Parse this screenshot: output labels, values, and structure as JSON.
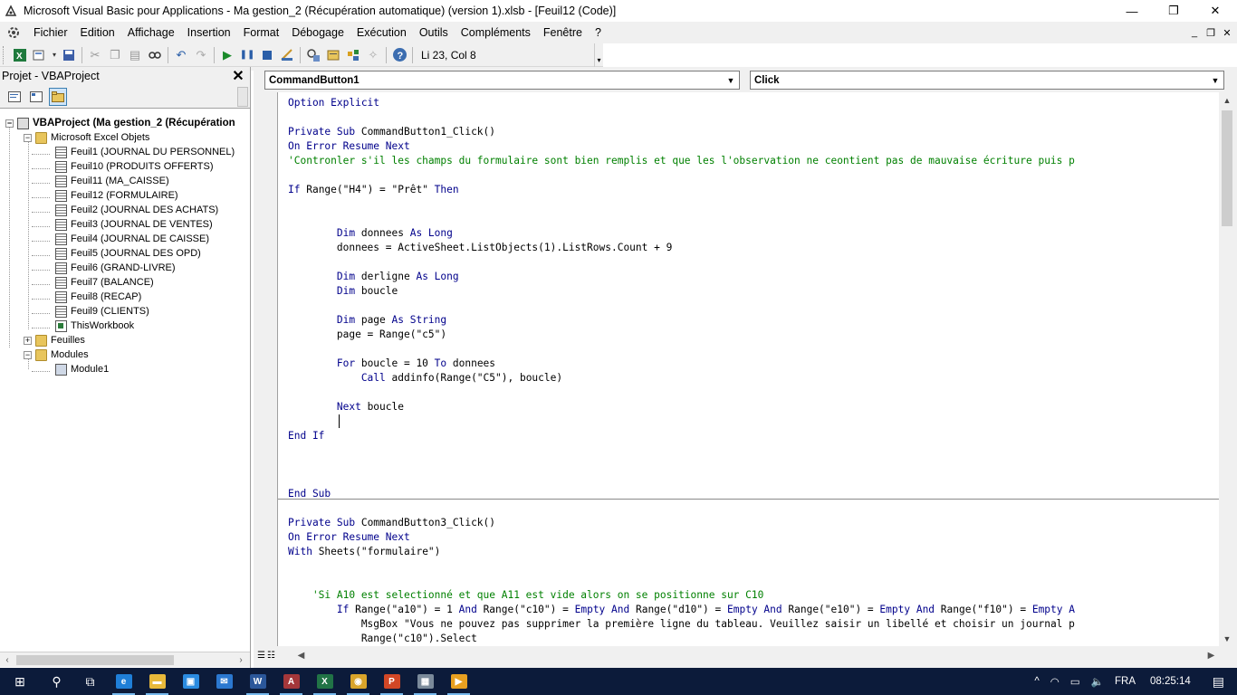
{
  "window": {
    "title": "Microsoft Visual Basic pour Applications - Ma gestion_2 (Récupération automatique) (version 1).xlsb - [Feuil12 (Code)]",
    "minimize": "—",
    "restore": "❐",
    "close": "✕"
  },
  "menu": {
    "items": [
      "Fichier",
      "Edition",
      "Affichage",
      "Insertion",
      "Format",
      "Débogage",
      "Exécution",
      "Outils",
      "Compléments",
      "Fenêtre",
      "?"
    ],
    "mdi_min": "_",
    "mdi_restore": "❐",
    "mdi_close": "✕"
  },
  "toolbar": {
    "status": "Li 23, Col 8",
    "icons": [
      "excel-icon",
      "insert-icon",
      "save-icon",
      "cut-icon",
      "copy-icon",
      "paste-icon",
      "find-icon",
      "undo-icon",
      "redo-icon",
      "run-icon",
      "pause-icon",
      "reset-icon",
      "design-mode-icon",
      "project-explorer-icon",
      "properties-icon",
      "object-browser-icon",
      "toolbox-icon",
      "help-icon"
    ]
  },
  "project": {
    "header": "Projet - VBAProject",
    "close_glyph": "✕",
    "tree": {
      "root": "VBAProject (Ma gestion_2 (Récupération",
      "excel_objects": "Microsoft Excel Objets",
      "sheets": [
        "Feuil1 (JOURNAL DU PERSONNEL)",
        "Feuil10 (PRODUITS OFFERTS)",
        "Feuil11 (MA_CAISSE)",
        "Feuil12 (FORMULAIRE)",
        "Feuil2 (JOURNAL DES ACHATS)",
        "Feuil3 (JOURNAL DE VENTES)",
        "Feuil4 (JOURNAL DE CAISSE)",
        "Feuil5 (JOURNAL DES OPD)",
        "Feuil6 (GRAND-LIVRE)",
        "Feuil7 (BALANCE)",
        "Feuil8 (RECAP)",
        "Feuil9 (CLIENTS)"
      ],
      "workbook": "ThisWorkbook",
      "feuilles": "Feuilles",
      "modules": "Modules",
      "module1": "Module1"
    }
  },
  "code": {
    "object_combo": "CommandButton1",
    "proc_combo": "Click",
    "lines": [
      [
        {
          "t": "Option Explicit",
          "c": "kw"
        }
      ],
      [],
      [
        {
          "t": "Private Sub ",
          "c": "kw"
        },
        {
          "t": "CommandButton1_Click()",
          "c": "tx"
        }
      ],
      [
        {
          "t": "On Error Resume Next",
          "c": "kw"
        }
      ],
      [
        {
          "t": "'Contronler s'il les champs du formulaire sont bien remplis et que les l'observation ne ceontient pas de mauvaise écriture puis p",
          "c": "cm"
        }
      ],
      [],
      [
        {
          "t": "If ",
          "c": "kw"
        },
        {
          "t": "Range(\"H4\") = \"Prêt\" ",
          "c": "tx"
        },
        {
          "t": "Then",
          "c": "kw"
        }
      ],
      [],
      [],
      [
        {
          "t": "        Dim ",
          "c": "kw"
        },
        {
          "t": "donnees ",
          "c": "tx"
        },
        {
          "t": "As Long",
          "c": "kw"
        }
      ],
      [
        {
          "t": "        donnees = ActiveSheet.ListObjects(1).ListRows.Count + 9",
          "c": "tx"
        }
      ],
      [],
      [
        {
          "t": "        Dim ",
          "c": "kw"
        },
        {
          "t": "derligne ",
          "c": "tx"
        },
        {
          "t": "As Long",
          "c": "kw"
        }
      ],
      [
        {
          "t": "        Dim ",
          "c": "kw"
        },
        {
          "t": "boucle",
          "c": "tx"
        }
      ],
      [],
      [
        {
          "t": "        Dim ",
          "c": "kw"
        },
        {
          "t": "page ",
          "c": "tx"
        },
        {
          "t": "As String",
          "c": "kw"
        }
      ],
      [
        {
          "t": "        page = Range(\"c5\")",
          "c": "tx"
        }
      ],
      [],
      [
        {
          "t": "        For ",
          "c": "kw"
        },
        {
          "t": "boucle = 10 ",
          "c": "tx"
        },
        {
          "t": "To ",
          "c": "kw"
        },
        {
          "t": "donnees",
          "c": "tx"
        }
      ],
      [
        {
          "t": "            Call ",
          "c": "kw"
        },
        {
          "t": "addinfo(Range(\"C5\"), boucle)",
          "c": "tx"
        }
      ],
      [],
      [
        {
          "t": "        Next ",
          "c": "kw"
        },
        {
          "t": "boucle",
          "c": "tx"
        }
      ],
      [],
      [
        {
          "t": "End If",
          "c": "kw"
        }
      ],
      [],
      [],
      [],
      [
        {
          "t": "End Sub",
          "c": "kw"
        }
      ],
      [],
      [
        {
          "t": "Private Sub ",
          "c": "kw"
        },
        {
          "t": "CommandButton3_Click()",
          "c": "tx"
        }
      ],
      [
        {
          "t": "On Error Resume Next",
          "c": "kw"
        }
      ],
      [
        {
          "t": "With ",
          "c": "kw"
        },
        {
          "t": "Sheets(\"formulaire\")",
          "c": "tx"
        }
      ],
      [],
      [],
      [
        {
          "t": "    'Si A10 est selectionné et que A11 est vide alors on se positionne sur C10",
          "c": "cm"
        }
      ],
      [
        {
          "t": "        If ",
          "c": "kw"
        },
        {
          "t": "Range(\"a10\") = 1 ",
          "c": "tx"
        },
        {
          "t": "And ",
          "c": "kw"
        },
        {
          "t": "Range(\"c10\") = ",
          "c": "tx"
        },
        {
          "t": "Empty And ",
          "c": "kw"
        },
        {
          "t": "Range(\"d10\") = ",
          "c": "tx"
        },
        {
          "t": "Empty And ",
          "c": "kw"
        },
        {
          "t": "Range(\"e10\") = ",
          "c": "tx"
        },
        {
          "t": "Empty And ",
          "c": "kw"
        },
        {
          "t": "Range(\"f10\") = ",
          "c": "tx"
        },
        {
          "t": "Empty A",
          "c": "kw"
        }
      ],
      [
        {
          "t": "            MsgBox ",
          "c": "tx"
        },
        {
          "t": "\"Vous ne pouvez pas supprimer la première ligne du tableau. Veuillez saisir un libellé et choisir un journal p",
          "c": "tx"
        }
      ],
      [
        {
          "t": "            Range(\"c10\").Select",
          "c": "tx"
        }
      ]
    ]
  },
  "taskbar": {
    "apps": [
      {
        "name": "start-button",
        "glyph": "⊞"
      },
      {
        "name": "search-button",
        "glyph": "⚲"
      },
      {
        "name": "task-view-button",
        "glyph": "⧉"
      },
      {
        "name": "edge-app",
        "glyph": "e",
        "color": "#1f7fd8"
      },
      {
        "name": "file-explorer-app",
        "glyph": "▬",
        "color": "#e8b93a"
      },
      {
        "name": "store-app",
        "glyph": "▣",
        "color": "#2b8be0"
      },
      {
        "name": "mail-app",
        "glyph": "✉",
        "color": "#2b78d0"
      },
      {
        "name": "word-app",
        "glyph": "W",
        "color": "#2b579a"
      },
      {
        "name": "access-app",
        "glyph": "A",
        "color": "#a4373a"
      },
      {
        "name": "excel-app",
        "glyph": "X",
        "color": "#217346"
      },
      {
        "name": "chrome-app",
        "glyph": "◉",
        "color": "#d9a42a"
      },
      {
        "name": "powerpoint-app",
        "glyph": "P",
        "color": "#d24726"
      },
      {
        "name": "vba-editor-app",
        "glyph": "▦",
        "color": "#7a8a9a"
      },
      {
        "name": "media-app",
        "glyph": "▶",
        "color": "#e8a020"
      }
    ],
    "tray": {
      "chevron": "^",
      "wifi": "◠",
      "battery": "▭",
      "volume": "🔈",
      "lang": "FRA",
      "time": "08:25:14",
      "notifications": "▤"
    }
  }
}
